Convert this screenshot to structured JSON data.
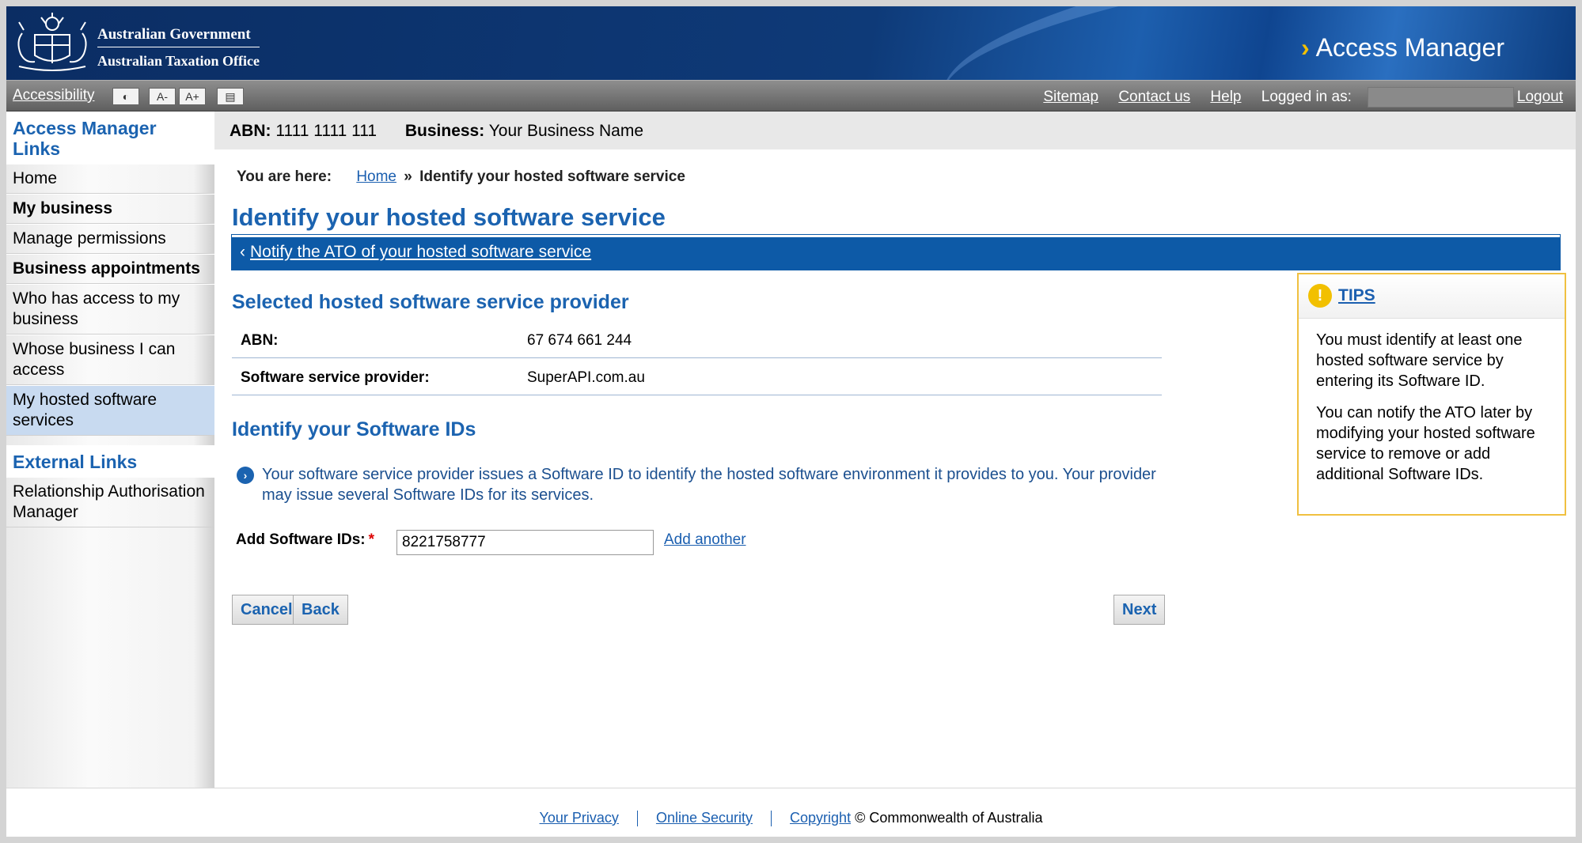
{
  "header": {
    "gov_line1": "Australian Government",
    "gov_line2": "Australian Taxation Office",
    "app_chevron": "›",
    "app_title": "Access Manager"
  },
  "toolbar": {
    "accessibility": "Accessibility",
    "contrast_btn": "◐",
    "font_smaller_btn": "A-",
    "font_larger_btn": "A+",
    "layout_btn": "▤",
    "sitemap": "Sitemap",
    "contact": "Contact us",
    "help": "Help",
    "logged_in_label": "Logged in as:",
    "logout": "Logout"
  },
  "sidebar": {
    "heading1": "Access Manager Links",
    "items": [
      {
        "label": "Home",
        "bold": false,
        "active": false
      },
      {
        "label": "My business",
        "bold": true,
        "active": false
      },
      {
        "label": "Manage permissions",
        "bold": false,
        "active": false
      },
      {
        "label": "Business appointments",
        "bold": true,
        "active": false
      },
      {
        "label": "Who has access to my business",
        "bold": false,
        "active": false
      },
      {
        "label": "Whose business I can access",
        "bold": false,
        "active": false
      },
      {
        "label": "My hosted software services",
        "bold": false,
        "active": true
      }
    ],
    "heading2": "External Links",
    "external_items": [
      "Relationship Authorisation Manager"
    ]
  },
  "context": {
    "abn_label": "ABN:",
    "abn_value": "1111 1111 111",
    "business_label": "Business:",
    "business_value": "Your Business Name"
  },
  "breadcrumb": {
    "label": "You are here:",
    "home": "Home",
    "sep": "»",
    "current": "Identify your hosted software service"
  },
  "page_title": "Identify your hosted software service",
  "back_link": {
    "chevron": "‹",
    "label": "Notify the ATO of your hosted software service"
  },
  "provider_section": {
    "heading": "Selected hosted software service provider",
    "rows": [
      {
        "key": "ABN:",
        "value": "67 674 661 244"
      },
      {
        "key": "Software service provider:",
        "value": "SuperAPI.com.au"
      }
    ]
  },
  "ids_section": {
    "heading": "Identify your Software IDs",
    "info_icon": "›",
    "info_text": "Your software service provider issues a Software ID to identify the hosted software environment it provides to you. Your provider may issue several Software IDs for its services.",
    "field_label": "Add Software IDs:",
    "required_marker": "*",
    "field_value": "8221758777",
    "add_another": "Add another"
  },
  "buttons": {
    "cancel": "Cancel",
    "back": "Back",
    "next": "Next"
  },
  "tips": {
    "icon": "!",
    "title": "TIPS",
    "p1": "You must identify at least one hosted software service by entering its Software ID.",
    "p2": "You can notify the ATO later by modifying your hosted software service to remove or add additional Software IDs."
  },
  "footer": {
    "privacy": "Your Privacy",
    "security": "Online Security",
    "copyright": "Copyright",
    "copyright_text": "© Commonwealth of Australia"
  },
  "colors": {
    "brand_blue": "#0d5aa7",
    "link_blue": "#1b5fb0",
    "tips_border": "#f0c040"
  }
}
